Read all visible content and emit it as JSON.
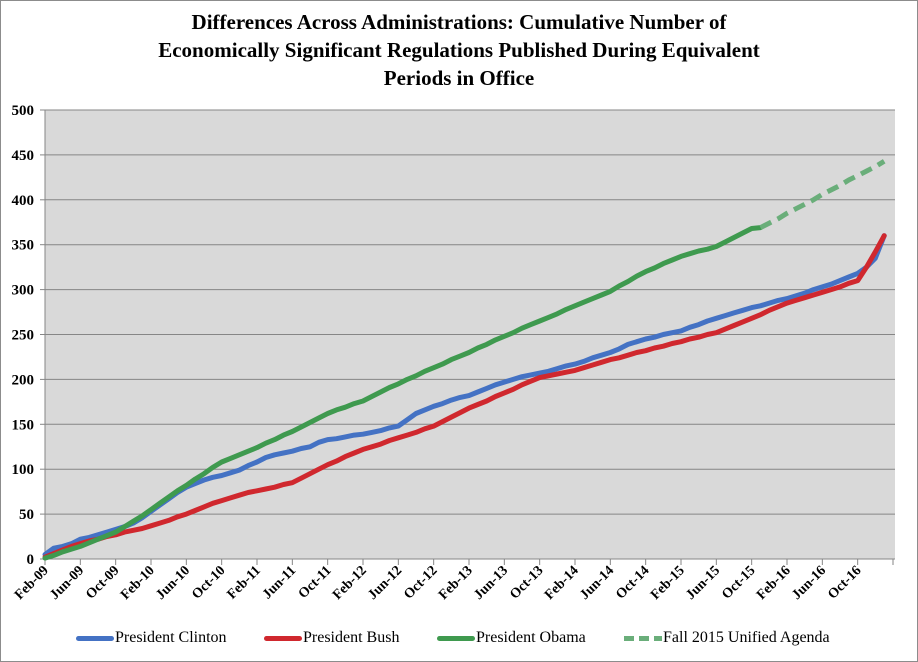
{
  "chart_data": {
    "type": "line",
    "title": "Differences Across Administrations: Cumulative Number of Economically Significant Regulations Published During Equivalent Periods in Office",
    "title_lines": [
      "Differences Across Administrations: Cumulative Number of",
      "Economically Significant Regulations Published During Equivalent",
      "Periods in Office"
    ],
    "xlabel": "",
    "ylabel": "",
    "ylim": [
      0,
      500
    ],
    "yticks": [
      0,
      50,
      100,
      150,
      200,
      250,
      300,
      350,
      400,
      450,
      500
    ],
    "grid": true,
    "legend_position": "bottom",
    "x_start": "Feb-09",
    "x_unit": "month",
    "x_range_months": [
      0,
      96
    ],
    "xticks": [
      "Feb-09",
      "Jun-09",
      "Oct-09",
      "Feb-10",
      "Jun-10",
      "Oct-10",
      "Feb-11",
      "Jun-11",
      "Oct-11",
      "Feb-12",
      "Jun-12",
      "Oct-12",
      "Feb-13",
      "Jun-13",
      "Oct-13",
      "Feb-14",
      "Jun-14",
      "Oct-14",
      "Feb-15",
      "Jun-15",
      "Oct-15",
      "Feb-16",
      "Jun-16",
      "Oct-16"
    ],
    "series": [
      {
        "name": "President Clinton",
        "color": "#4472c4",
        "dash": false,
        "start_month": 0,
        "values": [
          5,
          12,
          14,
          17,
          22,
          24,
          27,
          30,
          33,
          36,
          40,
          46,
          53,
          60,
          67,
          74,
          80,
          84,
          88,
          91,
          93,
          96,
          99,
          104,
          108,
          113,
          116,
          118,
          120,
          123,
          125,
          130,
          133,
          134,
          136,
          138,
          139,
          141,
          143,
          146,
          148,
          155,
          162,
          166,
          170,
          173,
          177,
          180,
          182,
          186,
          190,
          194,
          197,
          200,
          203,
          205,
          207,
          209,
          212,
          215,
          217,
          220,
          224,
          227,
          230,
          234,
          239,
          242,
          245,
          247,
          250,
          252,
          254,
          258,
          261,
          265,
          268,
          271,
          274,
          277,
          280,
          282,
          285,
          288,
          290,
          293,
          296,
          300,
          303,
          306,
          310,
          314,
          318,
          325,
          335,
          360
        ]
      },
      {
        "name": "President Bush",
        "color": "#d0282e",
        "dash": false,
        "start_month": 0,
        "values": [
          2,
          6,
          10,
          14,
          17,
          20,
          22,
          25,
          27,
          30,
          32,
          34,
          37,
          40,
          43,
          47,
          50,
          54,
          58,
          62,
          65,
          68,
          71,
          74,
          76,
          78,
          80,
          83,
          85,
          90,
          95,
          100,
          105,
          109,
          114,
          118,
          122,
          125,
          128,
          132,
          135,
          138,
          141,
          145,
          148,
          153,
          158,
          163,
          168,
          172,
          176,
          181,
          185,
          189,
          194,
          198,
          202,
          204,
          206,
          208,
          210,
          213,
          216,
          219,
          222,
          224,
          227,
          230,
          232,
          235,
          237,
          240,
          242,
          245,
          247,
          250,
          252,
          256,
          260,
          264,
          268,
          272,
          277,
          281,
          285,
          288,
          291,
          294,
          297,
          300,
          303,
          307,
          310,
          325,
          342,
          360
        ]
      },
      {
        "name": "President Obama",
        "color": "#3f9a4f",
        "dash": false,
        "start_month": 0,
        "values": [
          1,
          4,
          8,
          11,
          14,
          18,
          22,
          26,
          30,
          36,
          42,
          48,
          55,
          62,
          69,
          76,
          82,
          89,
          95,
          102,
          108,
          112,
          116,
          120,
          124,
          129,
          133,
          138,
          142,
          147,
          152,
          157,
          162,
          166,
          169,
          173,
          176,
          181,
          186,
          191,
          195,
          200,
          204,
          209,
          213,
          217,
          222,
          226,
          230,
          235,
          239,
          244,
          248,
          252,
          257,
          261,
          265,
          269,
          273,
          278,
          282,
          286,
          290,
          294,
          298,
          304,
          309,
          315,
          320,
          324,
          329,
          333,
          337,
          340,
          343,
          345,
          348,
          353,
          358,
          363,
          368,
          369
        ]
      },
      {
        "name": "Fall 2015 Unified Agenda",
        "color": "#6aae7a",
        "dash": true,
        "start_month": 81,
        "values": [
          369,
          374,
          379,
          385,
          390,
          395,
          400,
          406,
          411,
          416,
          422,
          427,
          432,
          437,
          443
        ]
      }
    ]
  },
  "legend": [
    {
      "label": "President Clinton"
    },
    {
      "label": "President Bush"
    },
    {
      "label": "President Obama"
    },
    {
      "label": "Fall 2015 Unified Agenda"
    }
  ]
}
